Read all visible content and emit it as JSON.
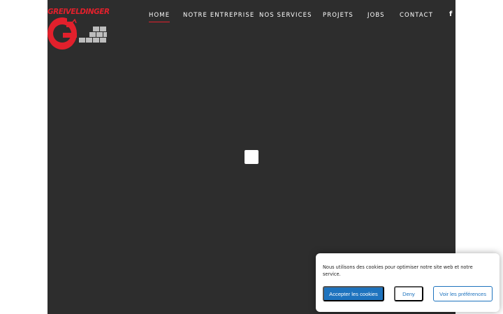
{
  "brand": {
    "name": "GREIVELDINGER",
    "color": "#e2202c"
  },
  "nav": {
    "items": [
      {
        "label": "HOME",
        "active": true
      },
      {
        "label": "NOTRE ENTREPRISE",
        "active": false
      },
      {
        "label": "NOS SERVICES",
        "active": false
      },
      {
        "label": "PROJETS",
        "active": false
      },
      {
        "label": "JOBS",
        "active": false
      },
      {
        "label": "CONTACT",
        "active": false
      }
    ],
    "social_icon": "facebook-icon",
    "social_glyph": "f"
  },
  "loader": {
    "icon": "loading-square-icon"
  },
  "cookie_banner": {
    "message": "Nous utilisons des cookies pour optimiser notre site web et notre service.",
    "accept_label": "Accepter les cookies",
    "deny_label": "Deny",
    "preferences_label": "Voir les préférences",
    "accent_color": "#1e73be"
  }
}
